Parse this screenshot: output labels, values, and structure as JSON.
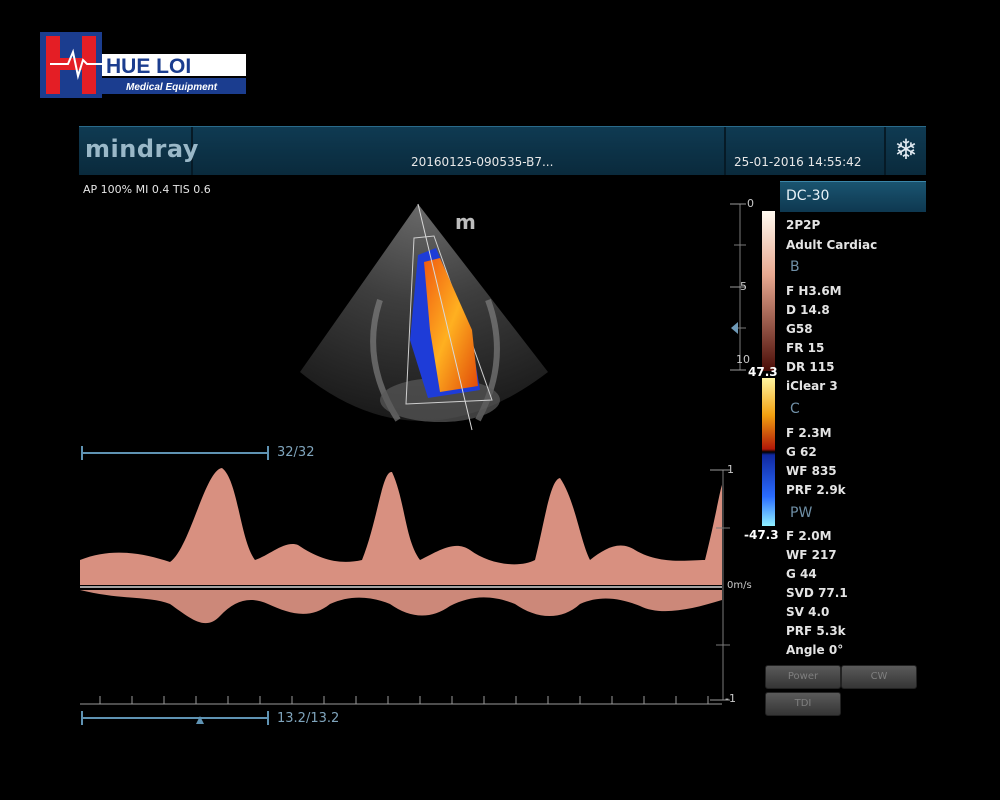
{
  "logo": {
    "text": "HUE LOI",
    "tagline": "Medical Equipment"
  },
  "header": {
    "brand": "mindray",
    "study_id": "20160125-090535-B7...",
    "datetime": "25-01-2016 14:55:42",
    "freeze_icon": "snowflake-icon"
  },
  "acoustic_info": "AP 100%  MI 0.4 TIS 0.6",
  "depth_scale": {
    "labels": [
      "0",
      "5",
      "10"
    ]
  },
  "color_scale": {
    "max": "47.3",
    "min": "-47.3"
  },
  "image_logo": "m",
  "doppler": {
    "top_indicator": "32/32",
    "bottom_indicator": "13.2/13.2",
    "velocity_top": "1",
    "velocity_unit": "m/s",
    "velocity_zero": "0",
    "velocity_bottom": "-1"
  },
  "right_panel": {
    "probe": "DC-30",
    "preset_items": [
      "2P2P",
      "Adult Cardiac"
    ],
    "b_mode": {
      "title": "B",
      "items": [
        "F H3.6M",
        "D 14.8",
        "G58",
        "FR 15",
        "DR 115",
        "iClear 3"
      ]
    },
    "c_mode": {
      "title": "C",
      "items": [
        "F 2.3M",
        "G 62",
        "WF 835",
        "PRF 2.9k"
      ]
    },
    "pw_mode": {
      "title": "PW",
      "items": [
        "F 2.0M",
        "WF 217",
        "G 44",
        "SVD 77.1",
        "SV 4.0",
        "PRF 5.3k",
        "Angle 0°"
      ]
    }
  },
  "soft_buttons": {
    "power": "Power",
    "cw": "CW",
    "tdi": "TDI"
  },
  "colors": {
    "header_bg": "#0f3a52",
    "accent_blue": "#5f93b3",
    "doppler": "#f2a08a"
  }
}
